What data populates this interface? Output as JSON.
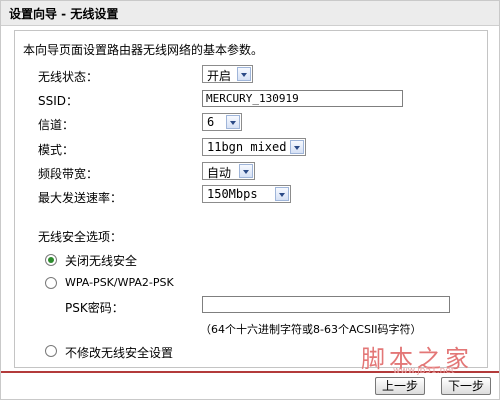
{
  "window": {
    "title": "设置向导 - 无线设置"
  },
  "intro": "本向导页面设置路由器无线网络的基本参数。",
  "fields": {
    "wireless_status": {
      "label": "无线状态：",
      "value": "开启"
    },
    "ssid": {
      "label": "SSID：",
      "value": "MERCURY_130919"
    },
    "channel": {
      "label": "信道：",
      "value": "6"
    },
    "mode": {
      "label": "模式：",
      "value": "11bgn mixed"
    },
    "bandwidth": {
      "label": "频段带宽：",
      "value": "自动"
    },
    "max_rate": {
      "label": "最大发送速率：",
      "value": "150Mbps"
    }
  },
  "security": {
    "heading": "无线安全选项：",
    "option_off": "关闭无线安全",
    "option_wpa": "WPA-PSK/WPA2-PSK",
    "psk_label": "PSK密码：",
    "psk_value": "",
    "psk_hint": "（64个十六进制字符或8-63个ACSII码字符）",
    "option_nochange": "不修改无线安全设置",
    "selected": "off"
  },
  "buttons": {
    "back": "上一步",
    "next": "下一步"
  },
  "watermark": {
    "text": "脚本之家",
    "url": "www.jb51.net"
  },
  "colors": {
    "footer_rule": "#b33b3b",
    "radio_checked": "#2e8b2e",
    "watermark": "#e37777"
  }
}
